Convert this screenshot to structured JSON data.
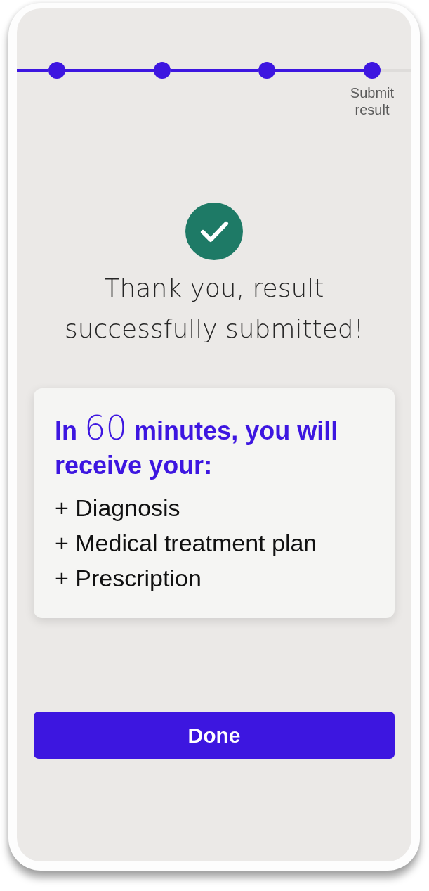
{
  "stepper": {
    "steps": [
      {
        "done": true
      },
      {
        "done": true
      },
      {
        "done": true
      },
      {
        "label": "Submit result",
        "done": true
      }
    ]
  },
  "confirmation": {
    "title": "Thank you, result successfully submitted!"
  },
  "info_card": {
    "heading": {
      "lead": "In",
      "number": "60",
      "rest": "minutes, you will receive your:"
    },
    "items": [
      "+ Diagnosis",
      "+ Medical treatment plan",
      "+ Prescription"
    ]
  },
  "buttons": [
    {
      "label": "Done"
    }
  ]
}
